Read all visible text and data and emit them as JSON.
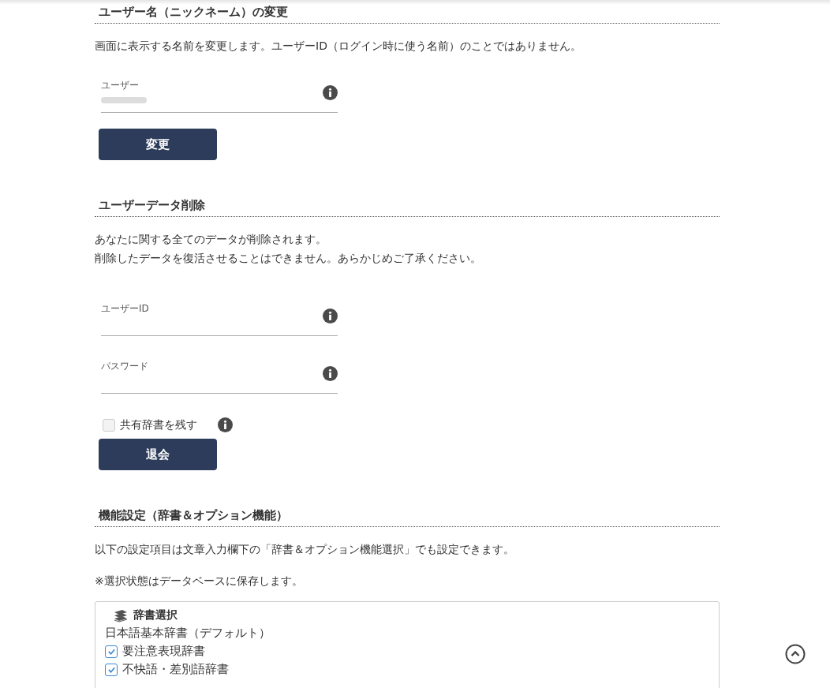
{
  "sections": [
    {
      "title": "ユーザー名（ニックネーム）の変更",
      "paragraphs": [
        {
          "lines": [
            "画面に表示する名前を変更します。ユーザーID（ログイン時に使う名前）のことではありません。"
          ]
        }
      ],
      "fields": [
        {
          "label": "ユーザー",
          "redacted": true
        }
      ],
      "button": "変更"
    },
    {
      "title": "ユーザーデータ削除",
      "paragraphs": [
        {
          "lines": [
            "あなたに関する全てのデータが削除されます。",
            "削除したデータを復活させることはできません。あらかじめご了承ください。"
          ]
        }
      ],
      "fields": [
        {
          "label": "ユーザーID"
        },
        {
          "label": "パスワード"
        }
      ],
      "checkbox": {
        "label": "共有辞書を残す",
        "checked": false
      },
      "button": "退会"
    },
    {
      "title": "機能設定（辞書＆オプション機能）",
      "paragraphs": [
        {
          "lines": [
            "以下の設定項目は文章入力欄下の「辞書＆オプション機能選択」でも設定できます。"
          ]
        },
        {
          "lines": [
            "※選択状態はデータベースに保存します。"
          ]
        }
      ],
      "panel": {
        "heading": "辞書選択",
        "default_item": "日本語基本辞書（デフォルト）",
        "items": [
          {
            "label": "要注意表現辞書",
            "checked": true
          },
          {
            "label": "不快語・差別語辞書",
            "checked": true
          }
        ]
      }
    }
  ]
}
